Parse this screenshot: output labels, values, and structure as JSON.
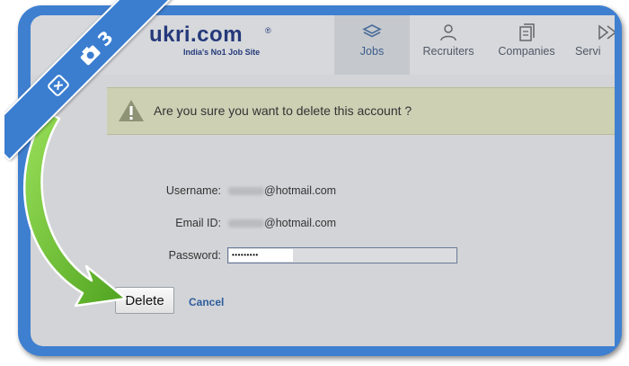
{
  "header": {
    "logo": "ukri.com",
    "tagline": "India's No1 Job Site",
    "nav": [
      {
        "label": "Jobs",
        "icon": "layers-icon"
      },
      {
        "label": "Recruiters",
        "icon": "users-icon"
      },
      {
        "label": "Companies",
        "icon": "building-icon"
      },
      {
        "label": "Servi",
        "icon": "forward-icon"
      }
    ]
  },
  "alert": {
    "icon": "warning-icon",
    "message": "Are you sure you want to delete this account ?"
  },
  "form": {
    "username_label": "Username:",
    "username_value": "@hotmail.com",
    "email_label": "Email ID:",
    "email_value": "@hotmail.com",
    "password_label": "Password:",
    "password_value": "•••••••••"
  },
  "actions": {
    "delete_label": "Delete",
    "cancel_label": "Cancel"
  },
  "ribbon": {
    "step": "3",
    "icons": [
      "remove-app-icon",
      "camera-icon"
    ]
  },
  "colors": {
    "frame": "#3f7fd0",
    "alert_bg": "#cdd0b3",
    "arrow": "#6cc12f",
    "link": "#2e5d9d"
  }
}
